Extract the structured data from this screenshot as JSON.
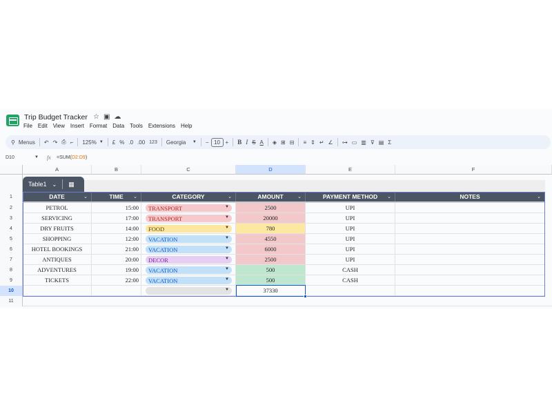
{
  "doc": {
    "title": "Trip Budget Tracker",
    "icons": [
      "star-icon",
      "folder-move-icon",
      "cloud-status-icon"
    ]
  },
  "menu": [
    "File",
    "Edit",
    "View",
    "Insert",
    "Format",
    "Data",
    "Tools",
    "Extensions",
    "Help"
  ],
  "toolbar": {
    "search_label": "Menus",
    "zoom": "125%",
    "currency": "£",
    "percent": "%",
    "dec_decrease": ".0",
    "dec_increase": ".00",
    "number_format": "123",
    "font": "Georgia",
    "font_size": "10",
    "bold": "B",
    "italic": "I",
    "strike": "S",
    "text_color": "A",
    "sum": "Σ"
  },
  "formula_bar": {
    "name_box": "D10",
    "fx": "fx",
    "formula_prefix": "=SUM(",
    "formula_ref": "D2:D9",
    "formula_suffix": ")"
  },
  "columns": [
    "A",
    "B",
    "C",
    "D",
    "E",
    "F"
  ],
  "selected_column": "D",
  "row_numbers": [
    "1",
    "2",
    "3",
    "4",
    "5",
    "6",
    "7",
    "8",
    "9",
    "10",
    "11"
  ],
  "table": {
    "name": "Table1",
    "headers": [
      "DATE",
      "TIME",
      "CATEGORY",
      "AMOUNT",
      "PAYMENT METHOD",
      "NOTES"
    ],
    "rows": [
      {
        "date": "PETROL",
        "time": "15:00",
        "category": "TRANSPORT",
        "amount": "2500",
        "payment": "UPI",
        "notes": ""
      },
      {
        "date": "SERVICING",
        "time": "17:00",
        "category": "TRANSPORT",
        "amount": "20000",
        "payment": "UPI",
        "notes": ""
      },
      {
        "date": "DRY FRUITS",
        "time": "14:00",
        "category": "FOOD",
        "amount": "780",
        "payment": "UPI",
        "notes": ""
      },
      {
        "date": "SHOPPING",
        "time": "12:00",
        "category": "VACATION",
        "amount": "4550",
        "payment": "UPI",
        "notes": ""
      },
      {
        "date": "HOTEL BOOKINGS",
        "time": "21:00",
        "category": "VACATION",
        "amount": "6000",
        "payment": "UPI",
        "notes": ""
      },
      {
        "date": "ANTIQUES",
        "time": "20:00",
        "category": "DECOR",
        "amount": "2500",
        "payment": "UPI",
        "notes": ""
      },
      {
        "date": "ADVENTURES",
        "time": "19:00",
        "category": "VACATION",
        "amount": "500",
        "payment": "CASH",
        "notes": ""
      },
      {
        "date": "TICKETS",
        "time": "22:00",
        "category": "VACATION",
        "amount": "500",
        "payment": "CASH",
        "notes": ""
      },
      {
        "date": "",
        "time": "",
        "category": "",
        "amount": "37330",
        "payment": "",
        "notes": ""
      }
    ]
  },
  "colors": {
    "transport_chip": "#f6c9cd",
    "food_chip": "#fde7a0",
    "vacation_chip": "#c2e0f7",
    "decor_chip": "#e6cff2",
    "empty_chip": "#e3e3e3",
    "amount_red": "#f3c8cb",
    "amount_yellow": "#fde8a1",
    "amount_green": "#bfe6cf",
    "header_bg": "#4b5563",
    "selection": "#0b57d0"
  }
}
